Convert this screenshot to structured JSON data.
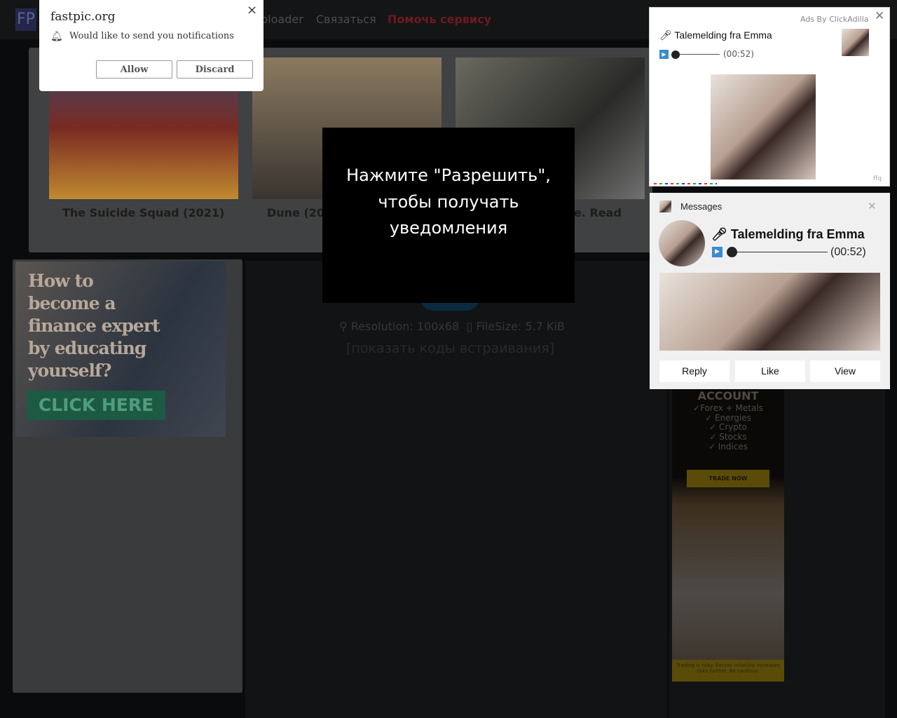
{
  "nav": {
    "logo": "FP",
    "links": [
      "ploader",
      "Связаться"
    ],
    "donate": "Помочь сервису"
  },
  "cards": [
    {
      "title": "The Suicide Squad (2021)"
    },
    {
      "title": "Dune (20"
    },
    {
      "title": "e. Read"
    }
  ],
  "left_ad": {
    "headline": "How to become a finance expert by educating yourself?",
    "button": "CLICK HERE"
  },
  "image_info": {
    "resolution": "Resolution: 100x68",
    "filesize": "FileSize: 5.7 KiB",
    "embed_link": "[показать коды встраивания]"
  },
  "trade_ad": {
    "heading": "ACCOUNT",
    "items": [
      "✓Forex + Metals",
      "✓ Energies",
      "✓ Crypto",
      "✓ Stocks",
      "✓ Indices"
    ],
    "button": "TRADE NOW",
    "disclaimer": "Trading is risky. Excess volatility increases risks further. Be cautious."
  },
  "prompt": {
    "text": "Нажмите \"Разрешить\", чтобы получать уведомления"
  },
  "notification": {
    "site": "fastpic.org",
    "message": "Would like to send you notifications",
    "allow": "Allow",
    "discard": "Discard",
    "close": "×"
  },
  "ad1": {
    "label": "Ads By ClickAdilla",
    "title": "Talemelding fra Emma",
    "duration": "(00:52)",
    "footer": "ffq",
    "close": "✕"
  },
  "ad2": {
    "header": "Messages",
    "title": "Talemelding fra Emma",
    "duration": "(00:52)",
    "close": "✕",
    "buttons": [
      "Reply",
      "Like",
      "View"
    ]
  }
}
